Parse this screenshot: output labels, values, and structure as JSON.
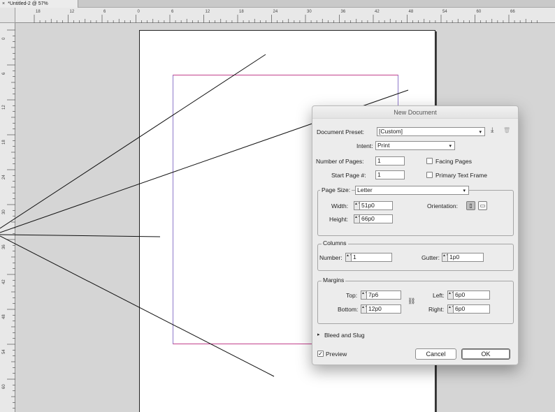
{
  "tab": {
    "title": "*Untitled-2 @ 57%",
    "close": "×"
  },
  "ruler": {
    "top": [
      "18",
      "12",
      "6",
      "0",
      "6",
      "12",
      "18",
      "24",
      "30",
      "36",
      "42",
      "48",
      "54",
      "60",
      "66"
    ],
    "left": [
      "0",
      "6",
      "12",
      "18",
      "24",
      "30",
      "36",
      "42",
      "48",
      "54",
      "60"
    ]
  },
  "dialog": {
    "title": "New Document",
    "preset_label": "Document Preset:",
    "preset_value": "[Custom]",
    "intent_label": "Intent:",
    "intent_value": "Print",
    "pages_label": "Number of Pages:",
    "pages_value": "1",
    "start_label": "Start Page #:",
    "start_value": "1",
    "facing_label": "Facing Pages",
    "facing_checked": false,
    "primary_label": "Primary Text Frame",
    "primary_checked": false,
    "page_size_label": "Page Size:",
    "page_size_value": "Letter",
    "width_label": "Width:",
    "width_value": "51p0",
    "height_label": "Height:",
    "height_value": "66p0",
    "orientation_label": "Orientation:",
    "columns_title": "Columns",
    "number_label": "Number:",
    "number_value": "1",
    "gutter_label": "Gutter:",
    "gutter_value": "1p0",
    "margins_title": "Margins",
    "top_label": "Top:",
    "top_value": "7p6",
    "bottom_label": "Bottom:",
    "bottom_value": "12p0",
    "left_label": "Left:",
    "left_value": "6p0",
    "right_label": "Right:",
    "right_value": "6p0",
    "bleed_label": "Bleed and Slug",
    "preview_label": "Preview",
    "preview_checked": true,
    "cancel_label": "Cancel",
    "ok_label": "OK",
    "checkmark": "✓",
    "arrow_down": "▾",
    "disclosure": "▸",
    "stepper_glyph": "▲▼",
    "link_glyph": "⛓",
    "save_glyph": "⤓",
    "trash_glyph": "🗑"
  },
  "colors": {
    "margin_guide": "#c2408c",
    "column_guide": "#8e78c9"
  }
}
